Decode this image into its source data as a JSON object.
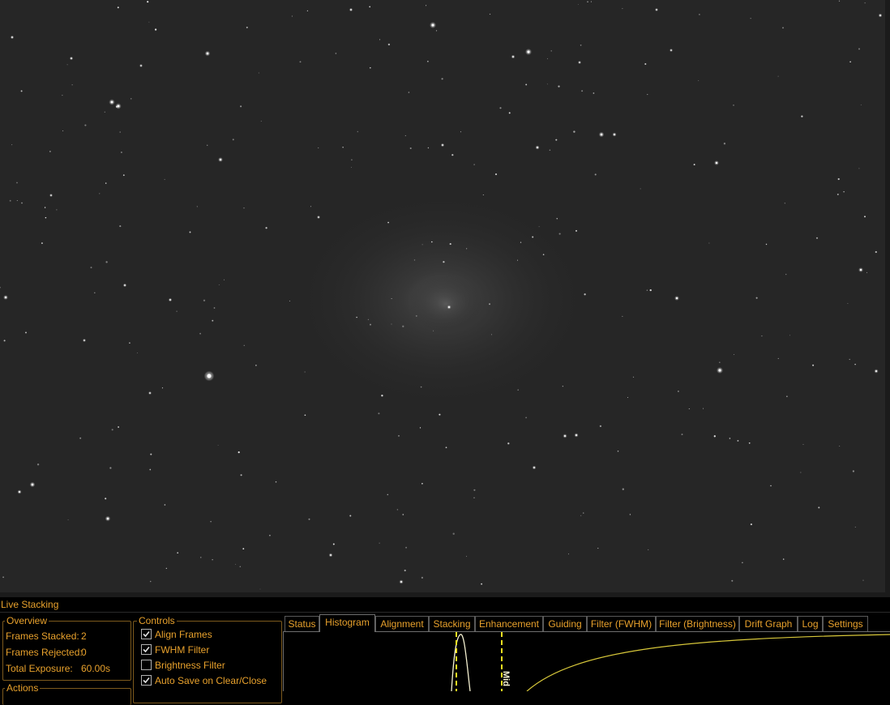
{
  "panel": {
    "title": "Live Stacking",
    "overview": {
      "legend": "Overview",
      "frames_stacked_label": "Frames Stacked:",
      "frames_stacked_value": "2",
      "frames_rejected_label": "Frames Rejected:",
      "frames_rejected_value": "0",
      "total_exposure_label": "Total Exposure:",
      "total_exposure_value": "60.00s"
    },
    "actions_legend": "Actions",
    "controls": {
      "legend": "Controls",
      "items": [
        {
          "label": "Align Frames",
          "checked": true
        },
        {
          "label": "FWHM Filter",
          "checked": true
        },
        {
          "label": "Brightness Filter",
          "checked": false
        },
        {
          "label": "Auto Save on Clear/Close",
          "checked": true
        }
      ]
    },
    "tabs": [
      "Status",
      "Histogram",
      "Alignment",
      "Stacking",
      "Enhancement",
      "Guiding",
      "Filter (FWHM)",
      "Filter (Brightness)",
      "Drift Graph",
      "Log",
      "Settings"
    ],
    "active_tab": "Histogram",
    "histogram": {
      "mid_marker_label": "Mid"
    }
  },
  "colors": {
    "accent": "#e8a12c",
    "sky_background": "#262626",
    "panel_background": "#000000",
    "histogram_curve": "#d8c83a",
    "marker": "#f0e020"
  }
}
